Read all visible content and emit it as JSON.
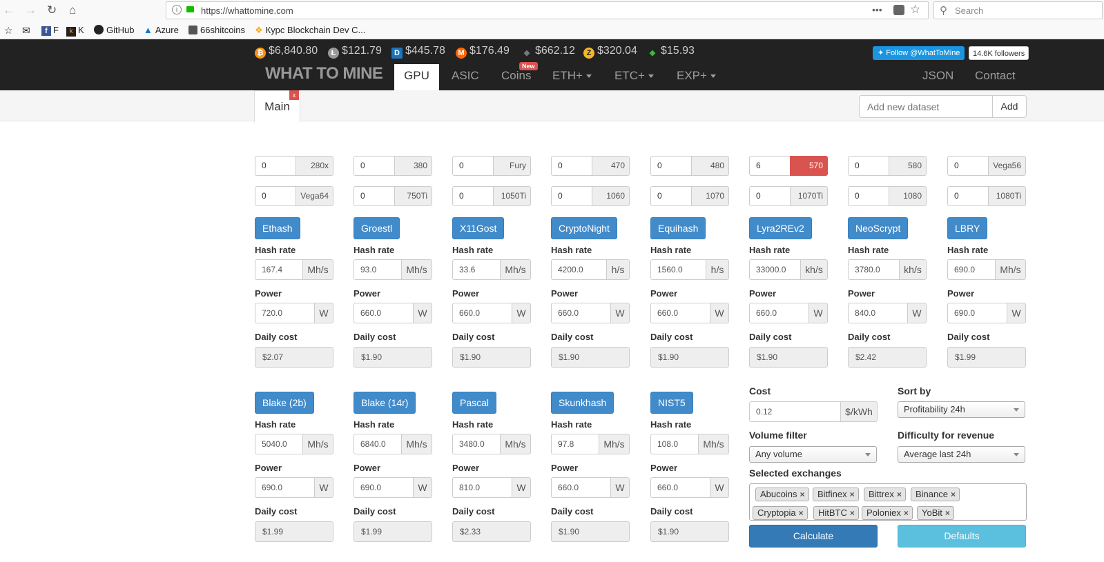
{
  "browser": {
    "url": "https://whattomine.com",
    "search_placeholder": "Search"
  },
  "bookmarks": [
    {
      "label": "",
      "icon": "bookmark-star-icon"
    },
    {
      "label": "",
      "icon": "mail-icon"
    },
    {
      "label": "F",
      "icon": "facebook-icon"
    },
    {
      "label": "K",
      "icon": "k-icon"
    },
    {
      "label": "GitHub",
      "icon": "github-icon"
    },
    {
      "label": "Azure",
      "icon": "azure-icon"
    },
    {
      "label": "66shitcoins",
      "icon": "cube-icon"
    },
    {
      "label": "Курс Blockchain Dev C...",
      "icon": "chain-icon"
    }
  ],
  "prices": [
    {
      "value": "$6,840.80",
      "icon": "bitcoin-icon",
      "color": "#f7931a"
    },
    {
      "value": "$121.79",
      "icon": "litecoin-icon",
      "color": "#999999"
    },
    {
      "value": "$445.78",
      "icon": "dash-icon",
      "color": "#1c75bc"
    },
    {
      "value": "$176.49",
      "icon": "monero-icon",
      "color": "#ff6600"
    },
    {
      "value": "$662.12",
      "icon": "ethereum-icon",
      "color": "#777777"
    },
    {
      "value": "$320.04",
      "icon": "zcash-icon",
      "color": "#f4b728"
    },
    {
      "value": "$15.93",
      "icon": "etc-icon",
      "color": "#3ab83a"
    }
  ],
  "brand": "WHAT TO MINE",
  "nav": {
    "gpu": "GPU",
    "asic": "ASIC",
    "coins": "Coins",
    "new_badge": "New",
    "eth": "ETH+",
    "etc": "ETC+",
    "exp": "EXP+",
    "json": "JSON",
    "contact": "Contact"
  },
  "twitter": {
    "follow": "Follow @WhatToMine",
    "followers": "14.6K followers"
  },
  "tabs": {
    "main": "Main",
    "close": "x",
    "dataset_placeholder": "Add new dataset",
    "add": "Add"
  },
  "gpus": [
    {
      "count": "0",
      "model": "280x",
      "selected": false
    },
    {
      "count": "0",
      "model": "380",
      "selected": false
    },
    {
      "count": "0",
      "model": "Fury",
      "selected": false
    },
    {
      "count": "0",
      "model": "470",
      "selected": false
    },
    {
      "count": "0",
      "model": "480",
      "selected": false
    },
    {
      "count": "6",
      "model": "570",
      "selected": true
    },
    {
      "count": "0",
      "model": "580",
      "selected": false
    },
    {
      "count": "0",
      "model": "Vega56",
      "selected": false
    },
    {
      "count": "0",
      "model": "Vega64",
      "selected": false
    },
    {
      "count": "0",
      "model": "750Ti",
      "selected": false
    },
    {
      "count": "0",
      "model": "1050Ti",
      "selected": false
    },
    {
      "count": "0",
      "model": "1060",
      "selected": false
    },
    {
      "count": "0",
      "model": "1070",
      "selected": false
    },
    {
      "count": "0",
      "model": "1070Ti",
      "selected": false
    },
    {
      "count": "0",
      "model": "1080",
      "selected": false
    },
    {
      "count": "0",
      "model": "1080Ti",
      "selected": false
    }
  ],
  "labels": {
    "hashrate": "Hash rate",
    "power": "Power",
    "daily_cost": "Daily cost",
    "watt": "W"
  },
  "algos": [
    {
      "name": "Ethash",
      "hashrate": "167.4",
      "unit": "Mh/s",
      "power": "720.0",
      "cost": "$2.07"
    },
    {
      "name": "Groestl",
      "hashrate": "93.0",
      "unit": "Mh/s",
      "power": "660.0",
      "cost": "$1.90"
    },
    {
      "name": "X11Gost",
      "hashrate": "33.6",
      "unit": "Mh/s",
      "power": "660.0",
      "cost": "$1.90"
    },
    {
      "name": "CryptoNight",
      "hashrate": "4200.0",
      "unit": "h/s",
      "power": "660.0",
      "cost": "$1.90"
    },
    {
      "name": "Equihash",
      "hashrate": "1560.0",
      "unit": "h/s",
      "power": "660.0",
      "cost": "$1.90"
    },
    {
      "name": "Lyra2REv2",
      "hashrate": "33000.0",
      "unit": "kh/s",
      "power": "660.0",
      "cost": "$1.90"
    },
    {
      "name": "NeoScrypt",
      "hashrate": "3780.0",
      "unit": "kh/s",
      "power": "840.0",
      "cost": "$2.42"
    },
    {
      "name": "LBRY",
      "hashrate": "690.0",
      "unit": "Mh/s",
      "power": "690.0",
      "cost": "$1.99"
    },
    {
      "name": "Blake (2b)",
      "hashrate": "5040.0",
      "unit": "Mh/s",
      "power": "690.0",
      "cost": "$1.99"
    },
    {
      "name": "Blake (14r)",
      "hashrate": "6840.0",
      "unit": "Mh/s",
      "power": "690.0",
      "cost": "$1.99"
    },
    {
      "name": "Pascal",
      "hashrate": "3480.0",
      "unit": "Mh/s",
      "power": "810.0",
      "cost": "$2.33"
    },
    {
      "name": "Skunkhash",
      "hashrate": "97.8",
      "unit": "Mh/s",
      "power": "660.0",
      "cost": "$1.90"
    },
    {
      "name": "NIST5",
      "hashrate": "108.0",
      "unit": "Mh/s",
      "power": "660.0",
      "cost": "$1.90"
    }
  ],
  "settings": {
    "cost_label": "Cost",
    "cost_value": "0.12",
    "cost_unit": "$/kWh",
    "sortby_label": "Sort by",
    "sortby_value": "Profitability 24h",
    "volume_label": "Volume filter",
    "volume_value": "Any volume",
    "difficulty_label": "Difficulty for revenue",
    "difficulty_value": "Average last 24h",
    "exchanges_label": "Selected exchanges",
    "exchanges": [
      "Abucoins",
      "Bitfinex",
      "Bittrex",
      "Binance",
      "Cryptopia",
      "HitBTC",
      "Poloniex",
      "YoBit"
    ],
    "remove": "×",
    "calculate": "Calculate",
    "defaults": "Defaults"
  }
}
